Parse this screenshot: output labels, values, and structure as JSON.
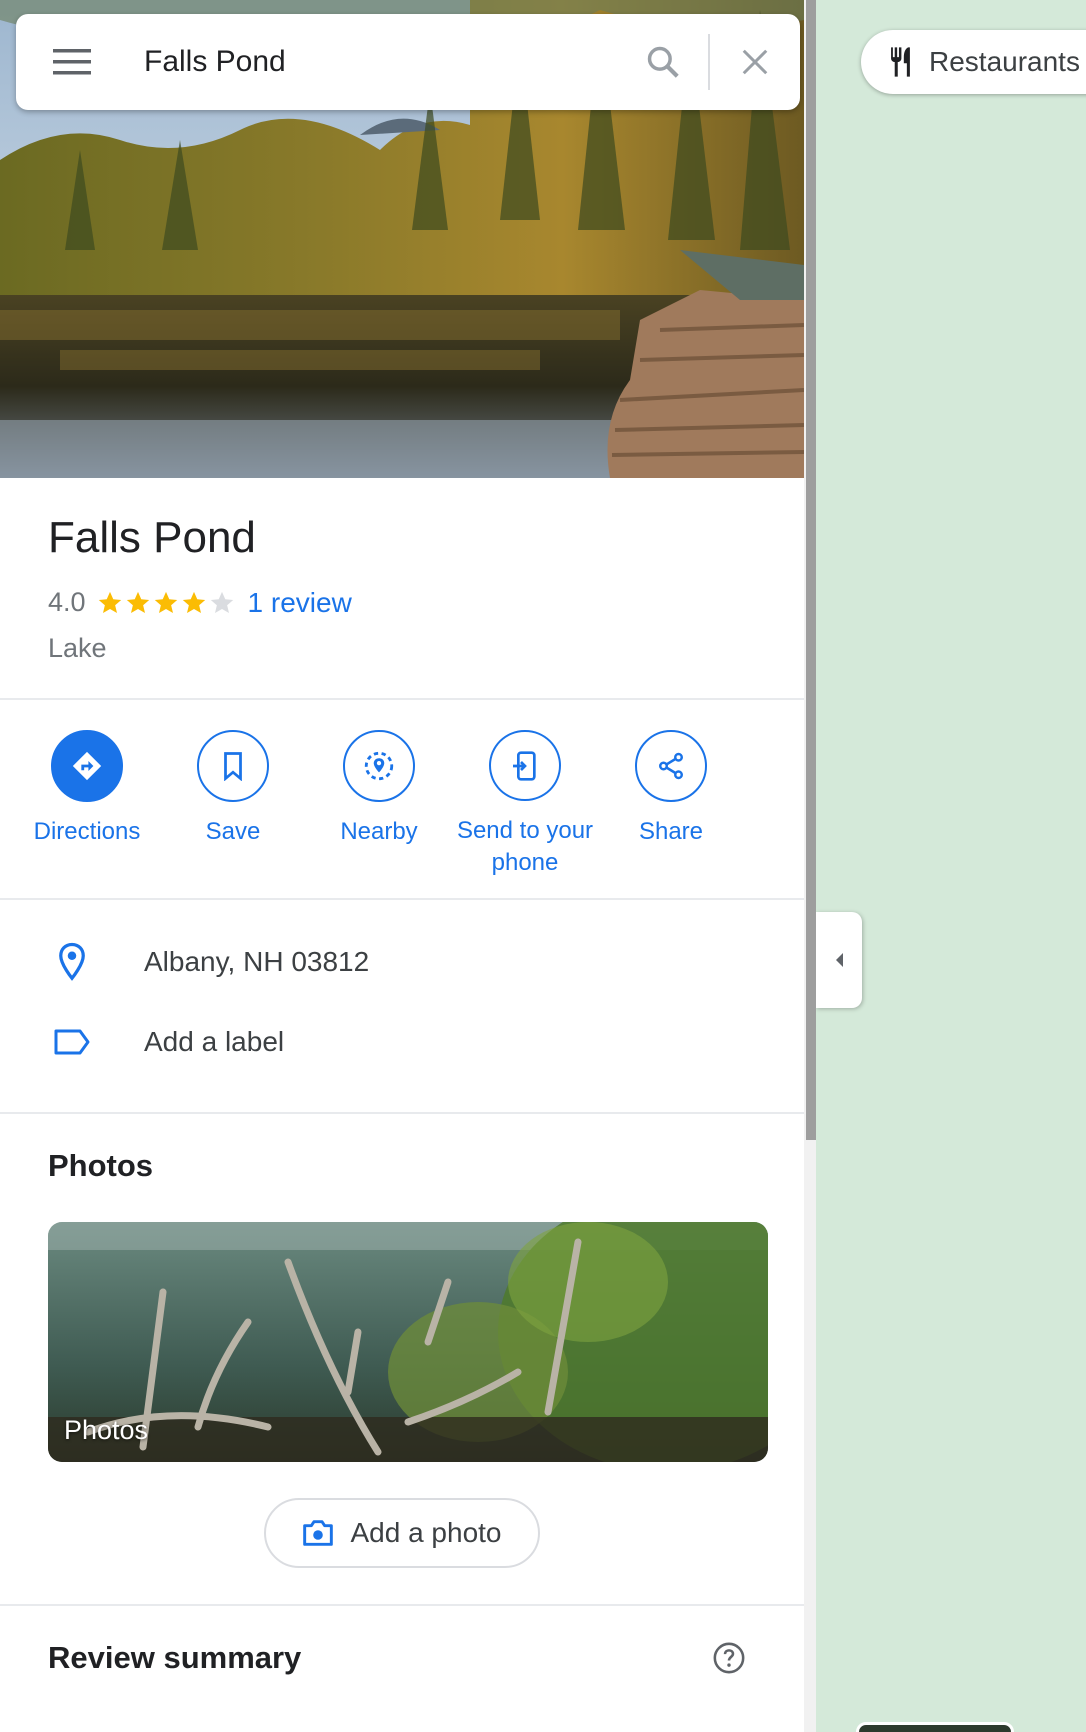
{
  "search": {
    "query": "Falls Pond"
  },
  "place": {
    "name": "Falls Pond",
    "rating": "4.0",
    "stars_filled": 4,
    "stars_total": 5,
    "reviews_label": "1 review",
    "category": "Lake"
  },
  "actions": [
    {
      "label": "Directions",
      "icon": "directions-icon"
    },
    {
      "label": "Save",
      "icon": "bookmark-icon"
    },
    {
      "label": "Nearby",
      "icon": "nearby-icon"
    },
    {
      "label": "Send to your phone",
      "icon": "send-to-phone-icon"
    },
    {
      "label": "Share",
      "icon": "share-icon"
    }
  ],
  "details": {
    "address": "Albany, NH 03812",
    "add_label": "Add a label"
  },
  "photos": {
    "title": "Photos",
    "card_caption": "Photos",
    "add_photo": "Add a photo"
  },
  "review_summary": {
    "title": "Review summary"
  },
  "map": {
    "chip_label": "Restaurants"
  },
  "colors": {
    "accent": "#1a73e8",
    "star": "#fbbc04",
    "star_empty": "#dadce0",
    "map_bg": "#d4e9d9"
  }
}
